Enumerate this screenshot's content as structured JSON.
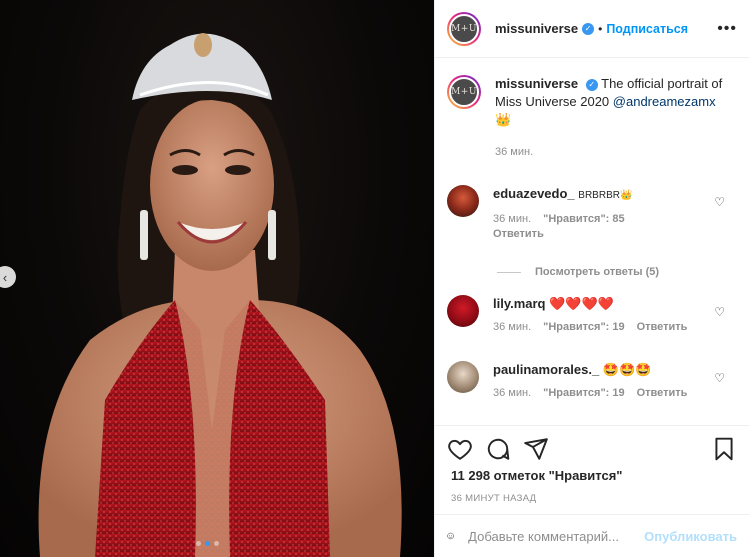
{
  "post": {
    "photo_alt": "",
    "username": "missuniverse",
    "avatar_text": "M+U",
    "follow_label": "Подписаться",
    "separator": "•",
    "more_label": "•••"
  },
  "caption": {
    "username": "missuniverse",
    "text": "The official portrait of Miss Universe 2020",
    "mention": "@andreamezamx",
    "emoji": "👑",
    "time": "36 мин."
  },
  "comments": [
    {
      "username": "eduazevedo_",
      "text": "BRBRBR👑",
      "time": "36 мин.",
      "likes": "\"Нравится\": 85",
      "reply": "Ответить",
      "view_replies": "Посмотреть ответы (5)"
    },
    {
      "username": "lily.marq",
      "text": "❤️❤️❤️❤️",
      "time": "36 мин.",
      "likes": "\"Нравится\": 19",
      "reply": "Ответить"
    },
    {
      "username": "paulinamorales._",
      "text": "🤩🤩🤩",
      "time": "36 мин.",
      "likes": "\"Нравится\": 19",
      "reply": "Ответить"
    }
  ],
  "actions": {
    "likes_count": "11 298 отметок \"Нравится\"",
    "posted_ago": "36 МИНУТ НАЗАД"
  },
  "add_comment": {
    "placeholder": "Добавьте комментарий...",
    "publish_label": "Опубликовать"
  },
  "carousel": {
    "prev_icon": "chevron-left-icon",
    "total": 3,
    "active": 2
  },
  "colors": {
    "accent": "#0095f6",
    "verified": "#3897f0",
    "mention": "#00376b",
    "muted": "#8e8e8e"
  }
}
